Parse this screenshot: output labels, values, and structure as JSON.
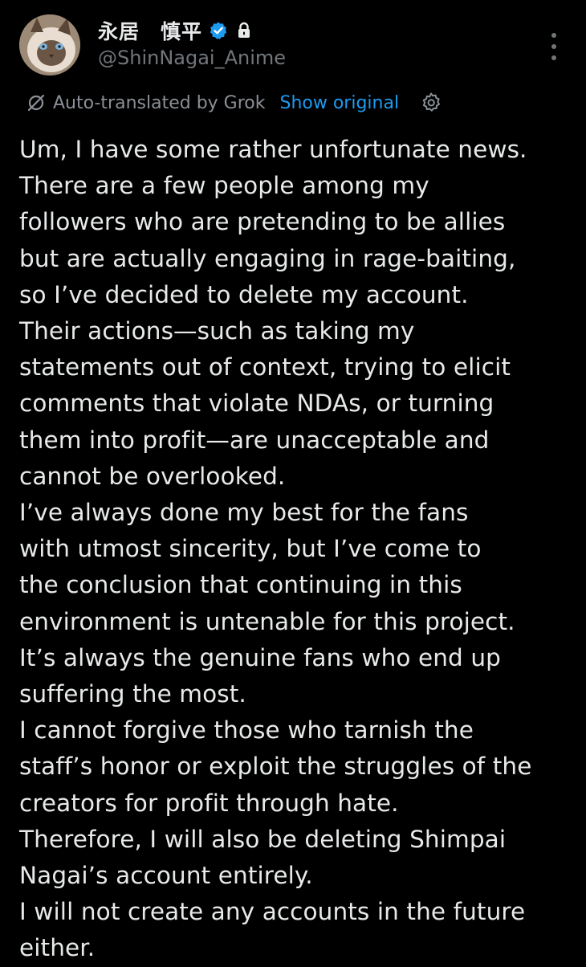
{
  "author": {
    "display_name": "永居　慎平",
    "handle": "@ShinNagai_Anime",
    "avatar_icon": "cat-avatar",
    "verified_icon": "verified-badge-icon",
    "protected_icon": "lock-icon"
  },
  "translation": {
    "label": "Auto-translated by Grok",
    "show_original": "Show original",
    "icon": "translate-icon",
    "settings_icon": "gear-icon"
  },
  "post": {
    "lines": [
      "Um, I have some rather unfortunate news.",
      "There are a few people among my",
      "followers who are pretending to be allies",
      "but are actually engaging in rage-baiting,",
      "so I’ve decided to delete my account.",
      "Their actions—such as taking my",
      "statements out of context, trying to elicit",
      "comments that violate NDAs, or turning",
      "them into profit—are unacceptable and",
      "cannot be overlooked.",
      "I’ve always done my best for the fans",
      "with utmost sincerity, but I’ve come to",
      "the conclusion that continuing in this",
      "environment is untenable for this project.",
      "It’s always the genuine fans who end up",
      "suffering the most.",
      "I cannot forgive those who tarnish the",
      "staff’s honor or exploit the struggles of the",
      "creators for profit through hate.",
      "Therefore, I will also be deleting Shimpai",
      "Nagai’s account entirely.",
      "I will not create any accounts in the future",
      "either."
    ]
  },
  "colors": {
    "background": "#000000",
    "text_primary": "#e7e9ea",
    "text_secondary": "#71767b",
    "link": "#1d9bf0",
    "verified": "#1d9bf0"
  }
}
